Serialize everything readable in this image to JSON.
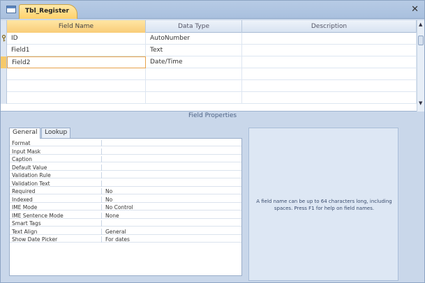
{
  "tab": {
    "title": "Tbl_Register"
  },
  "grid": {
    "headers": {
      "field_name": "Field Name",
      "data_type": "Data Type",
      "description": "Description"
    },
    "rows": [
      {
        "name": "ID",
        "type": "AutoNumber",
        "description": ""
      },
      {
        "name": "Field1",
        "type": "Text",
        "description": ""
      },
      {
        "name": "Field2",
        "type": "Date/Time",
        "description": ""
      }
    ]
  },
  "field_properties": {
    "title": "Field Properties",
    "tabs": {
      "general": "General",
      "lookup": "Lookup"
    },
    "rows": [
      {
        "label": "Format",
        "value": ""
      },
      {
        "label": "Input Mask",
        "value": ""
      },
      {
        "label": "Caption",
        "value": ""
      },
      {
        "label": "Default Value",
        "value": ""
      },
      {
        "label": "Validation Rule",
        "value": ""
      },
      {
        "label": "Validation Text",
        "value": ""
      },
      {
        "label": "Required",
        "value": "No"
      },
      {
        "label": "Indexed",
        "value": "No"
      },
      {
        "label": "IME Mode",
        "value": "No Control"
      },
      {
        "label": "IME Sentence Mode",
        "value": "None"
      },
      {
        "label": "Smart Tags",
        "value": ""
      },
      {
        "label": "Text Align",
        "value": "General"
      },
      {
        "label": "Show Date Picker",
        "value": "For dates"
      }
    ],
    "help": "A field name can be up to 64 characters long, including spaces. Press F1 for help on field names."
  },
  "icons": {
    "table": "table-icon",
    "close": "close-icon",
    "primary_key": "key-icon"
  },
  "colors": {
    "accent_tab": "#ffd16a",
    "chrome": "#c9d7ea"
  }
}
